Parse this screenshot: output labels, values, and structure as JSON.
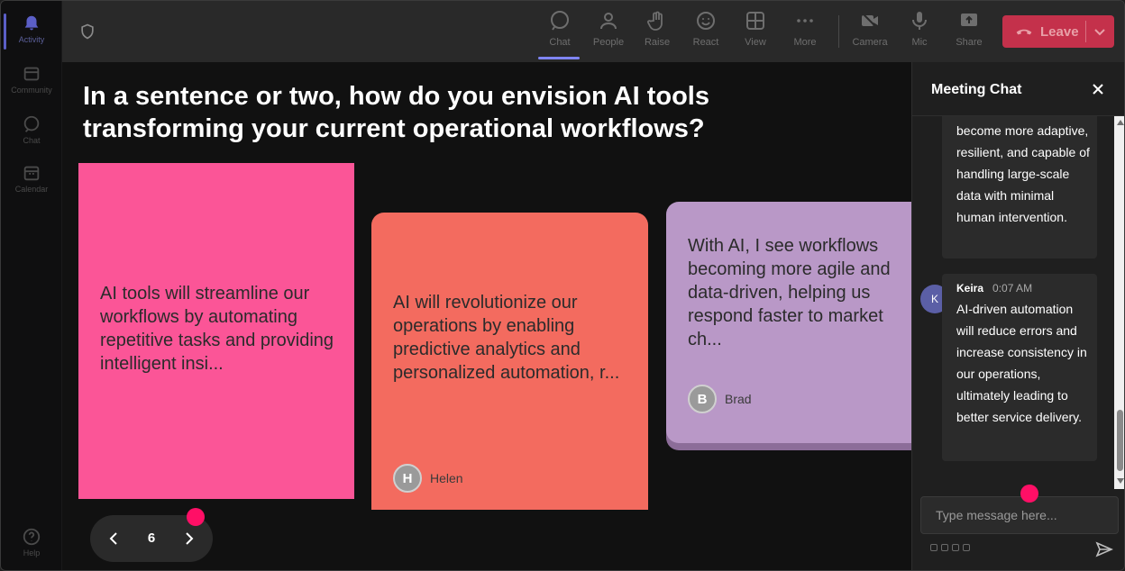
{
  "rail": {
    "items": [
      {
        "label": "Activity",
        "icon": "bell-icon",
        "active": true
      },
      {
        "label": "Community",
        "icon": "community-icon"
      },
      {
        "label": "Chat",
        "icon": "chat-icon"
      },
      {
        "label": "Calendar",
        "icon": "calendar-icon"
      },
      {
        "label": "Help",
        "icon": "help-icon"
      }
    ]
  },
  "toolbar": {
    "chat": "Chat",
    "people": "People",
    "raise": "Raise",
    "react": "React",
    "view": "View",
    "more": "More",
    "camera": "Camera",
    "mic": "Mic",
    "share": "Share",
    "leave": "Leave"
  },
  "stage": {
    "question": "In a sentence or two, how do you envision AI tools transforming your current operational workflows?",
    "cards": [
      {
        "text": "AI tools will streamline our workflows by automating repetitive tasks and providing intelligent insi...",
        "color": "#fb5597"
      },
      {
        "text": "AI will revolutionize our operations by enabling predictive analytics and personalized automation, r...",
        "author": "Helen",
        "initial": "H",
        "color": "#f36b5f"
      },
      {
        "text": "With AI, I see workflows becoming more agile and data-driven, helping us respond faster to market ch...",
        "author": "Brad",
        "initial": "B",
        "color": "#b998c7"
      }
    ],
    "page": "6"
  },
  "chat": {
    "title": "Meeting Chat",
    "messages": [
      {
        "text": "become more adaptive, resilient, and capable of handling large-scale data with minimal human intervention."
      },
      {
        "author": "Keira",
        "initial": "K",
        "time": "0:07 AM",
        "text": "AI-driven automation will reduce errors and increase consistency in our operations, ultimately leading to better service delivery."
      }
    ],
    "placeholder": "Type message here..."
  },
  "colors": {
    "accent": "#7f85f5",
    "leave": "#c4314b",
    "marker": "#ff0f66"
  }
}
